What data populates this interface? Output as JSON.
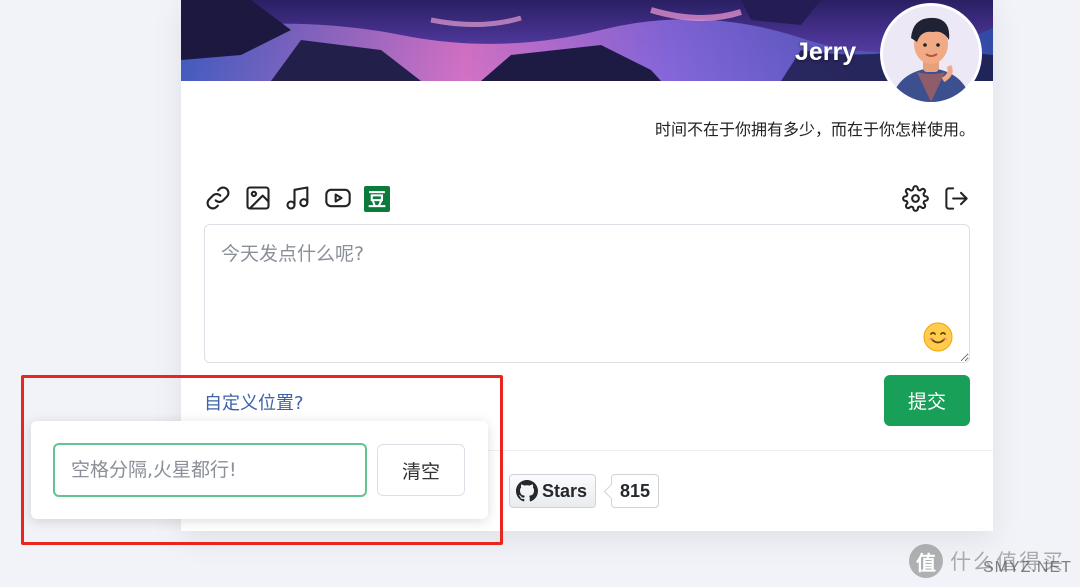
{
  "profile": {
    "name": "Jerry",
    "motto": "时间不在于你拥有多少，而在于你怎样使用。"
  },
  "toolbar": {
    "icons": [
      "link-icon",
      "image-icon",
      "music-icon",
      "video-icon",
      "douban-icon",
      "settings-icon",
      "logout-icon"
    ],
    "douban_glyph": "豆"
  },
  "composer": {
    "placeholder": "今天发点什么呢?",
    "value": "",
    "emoji_icon": "smile-emoji-icon"
  },
  "location": {
    "link_label": "自定义位置?",
    "input_placeholder": "空格分隔,火星都行!",
    "input_value": "",
    "clear_label": "清空"
  },
  "submit_label": "提交",
  "github": {
    "stars_label": "Stars",
    "stars_count": "815"
  },
  "watermark": {
    "glyph": "值",
    "text": "什么值得买",
    "sub": "SMYZ.NET"
  },
  "colors": {
    "accent": "#18a058",
    "link": "#3e62a8",
    "highlight_frame": "#e8261c"
  }
}
